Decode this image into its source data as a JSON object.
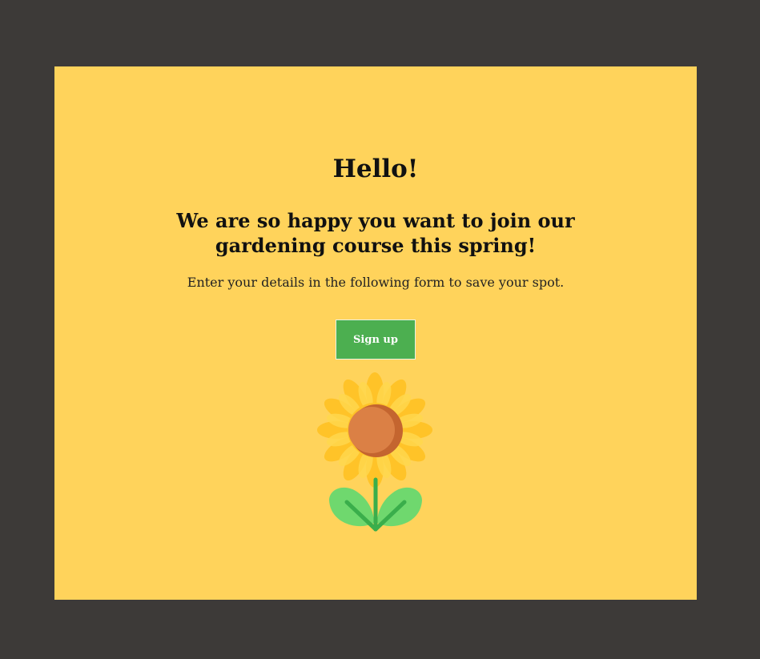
{
  "card": {
    "title": "Hello!",
    "subtitle": "We are so happy you want to join our gardening course this spring!",
    "lead": "Enter your details in the following form to save your spot.",
    "button_label": "Sign up",
    "illustration": "sunflower-icon"
  },
  "colors": {
    "page_background": "#3d3a38",
    "card_background": "#ffd35b",
    "button_background": "#4caf50",
    "button_text": "#ffffff",
    "petal": "#ffc328",
    "flower_center": "#d97e45",
    "leaf": "#6fd86e",
    "stem": "#3aae4b"
  }
}
